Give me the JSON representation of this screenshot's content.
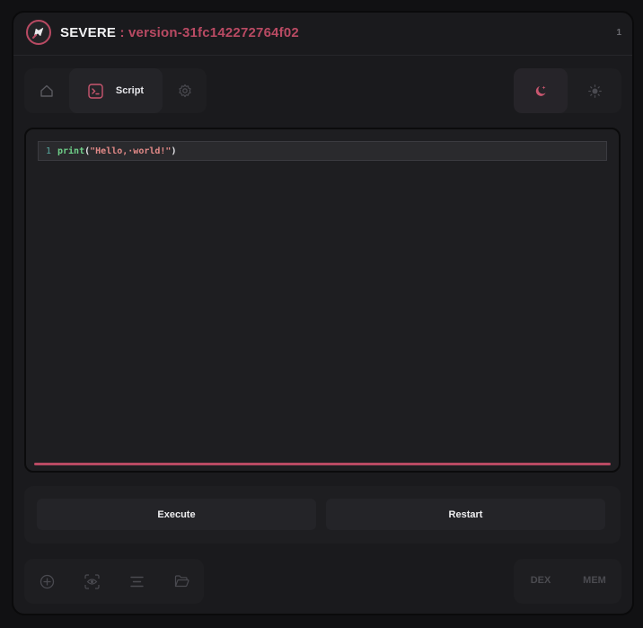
{
  "header": {
    "app_name": "SEVERE",
    "separator": ":",
    "version": "version-31fc142272764f02",
    "badge": "1"
  },
  "nav": {
    "tabs": [
      {
        "icon": "home-icon",
        "label": ""
      },
      {
        "icon": "terminal-icon",
        "label": "Script"
      },
      {
        "icon": "gear-icon",
        "label": ""
      }
    ],
    "active_tab": "Script"
  },
  "theme": {
    "options": [
      "dark",
      "light"
    ],
    "selected": "dark"
  },
  "editor": {
    "lines": [
      {
        "number": "1",
        "fn": "print",
        "open": "(",
        "string": "\"Hello,·world!\"",
        "close": ")"
      }
    ],
    "progress": 1.0
  },
  "actions": {
    "execute_label": "Execute",
    "restart_label": "Restart"
  },
  "toolbar": {
    "icons": [
      "add-circle-icon",
      "eye-scan-icon",
      "align-icon",
      "folder-open-icon"
    ]
  },
  "bottom_right": {
    "dex_label": "DEX",
    "mem_label": "MEM"
  },
  "colors": {
    "accent": "#b94a63",
    "background": "#1a1a1d",
    "panel": "#1e1e21"
  }
}
